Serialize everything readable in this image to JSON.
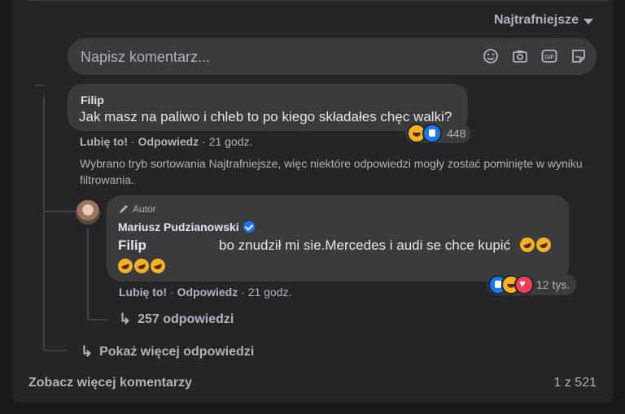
{
  "sort": {
    "label": "Najtrafniejsze"
  },
  "composer": {
    "placeholder": "Napisz komentarz...",
    "icons": [
      "emoji-icon",
      "camera-icon",
      "gif-icon",
      "sticker-icon"
    ]
  },
  "comment1": {
    "author": "Filip",
    "text": "Jak masz na paliwo i chleb to po kiego składałes chęc walki?",
    "reaction_count": "448",
    "like_label": "Lubię to!",
    "reply_label": "Odpowiedz",
    "time": "21 godz."
  },
  "sort_note": "Wybrano tryb sortowania Najtrafniejsze, więc niektóre odpowiedzi mogły zostać pominięte w wyniku filtrowania.",
  "reply": {
    "badge": "Autor",
    "author": "Mariusz Pudzianowski",
    "mention": "Filip",
    "text": "bo znudził mi sie.Mercedes i audi se chce kupić",
    "reaction_count": "12 tys.",
    "like_label": "Lubię to!",
    "reply_label": "Odpowiedz",
    "time": "21 godz.",
    "replies_label": "257 odpowiedzi"
  },
  "more_replies": "Pokaż więcej odpowiedzi",
  "footer": {
    "see_more": "Zobacz więcej komentarzy",
    "pagination": "1 z 521"
  },
  "colors": {
    "background": "#18191a",
    "panel": "#242526",
    "bubble": "#3a3b3c",
    "text": "#e4e6eb",
    "muted": "#b0b3b8",
    "accent": "#1877f2"
  }
}
